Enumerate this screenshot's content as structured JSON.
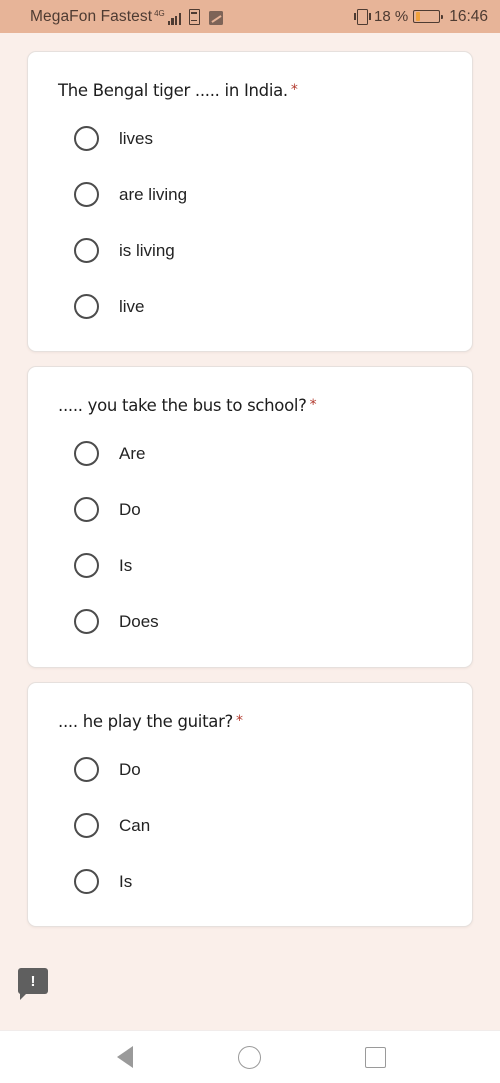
{
  "status_bar": {
    "carrier": "MegaFon Fastest",
    "network_type": "4G",
    "signal_icon": "signal-bars-icon",
    "sim_icon": "sim-card-icon",
    "app_icon": "app-notification-icon",
    "vibrate_icon": "vibrate-mode-icon",
    "battery_percent": "18 %",
    "battery_level": 18,
    "battery_icon": "battery-icon",
    "clock": "16:46",
    "background_color": "#e7b498",
    "text_color": "#4e3b32",
    "battery_fill_color": "#f0a23c"
  },
  "page": {
    "background_color": "#faefea",
    "required_marker": "*",
    "required_marker_color": "#b23a2e"
  },
  "questions": [
    {
      "text": "The Bengal tiger ..... in India.",
      "required": true,
      "options": [
        "lives",
        "are living",
        "is living",
        "live"
      ]
    },
    {
      "text": "..... you take the bus to school?",
      "required": true,
      "options": [
        "Are",
        "Do",
        "Is",
        "Does"
      ]
    },
    {
      "text": ".... he play the guitar?",
      "required": true,
      "options": [
        "Do",
        "Can",
        "Is"
      ]
    }
  ],
  "warning_bubble": {
    "icon": "exclamation-icon",
    "label": "!",
    "background_color": "#5f5f5f"
  },
  "nav_bar": {
    "back_icon": "back-triangle-icon",
    "home_icon": "home-circle-icon",
    "recents_icon": "recents-square-icon",
    "icon_color": "#9a9a9a"
  }
}
